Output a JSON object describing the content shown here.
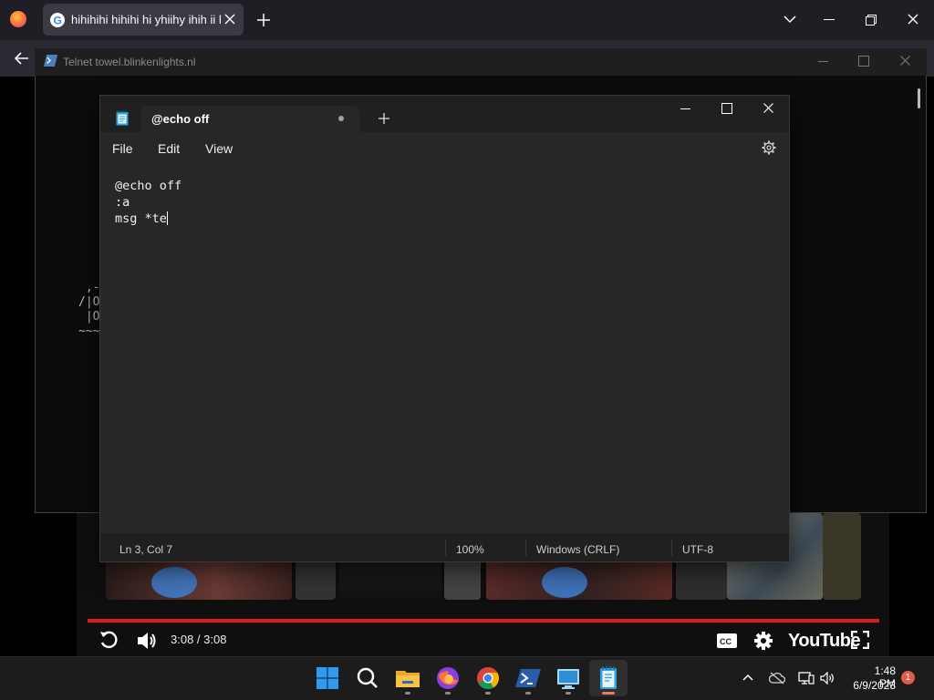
{
  "browser": {
    "tab_title": "hihihihi hihihi hi yhiihy ihih ii hi",
    "window_controls": [
      "chevron-down-icon",
      "minimize-icon",
      "restore-icon",
      "close-icon"
    ]
  },
  "telnet": {
    "title": "Telnet towel.blinkenlights.nl",
    "ascii_art": " ,-\n/|O\n |O\n~~~"
  },
  "notepad": {
    "tab_title": "@echo off",
    "menu": [
      "File",
      "Edit",
      "View"
    ],
    "content": "@echo off\n:a\nmsg *te",
    "status": {
      "position": "Ln 3, Col 7",
      "zoom": "100%",
      "line_ending": "Windows (CRLF)",
      "encoding": "UTF-8"
    }
  },
  "video": {
    "time": "3:08 / 3:08",
    "logo": "YouTube",
    "progress": 1.0,
    "progress_color": "#e01b1b"
  },
  "taskbar": {
    "apps": [
      "windows-start-icon",
      "search-icon",
      "file-explorer-icon",
      "firefox-icon",
      "chrome-icon",
      "powershell-icon",
      "remote-desktop-icon",
      "notepad-icon"
    ],
    "time": "1:48 PM",
    "date": "6/9/2023",
    "notifications": "1"
  }
}
